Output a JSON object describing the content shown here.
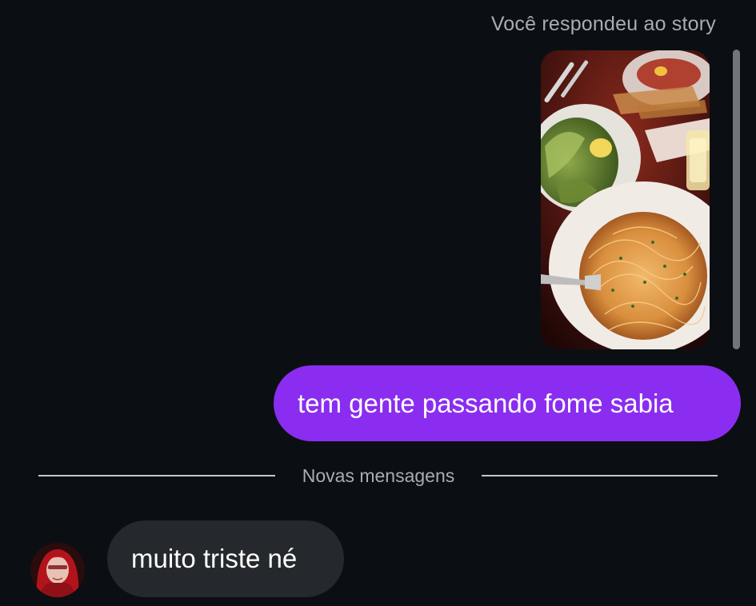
{
  "thread": {
    "story_reply_caption": "Você respondeu ao story",
    "story_preview": {
      "image_description": "story photo of plates of spaghetti and salad on a restaurant table"
    },
    "sent_message": "tem gente passando fome sabia",
    "new_messages_divider": "Novas mensagens",
    "received_message": "muito triste né",
    "avatar": {
      "icon": "user-avatar"
    }
  },
  "colors": {
    "background": "#0b0f13",
    "sent_bubble": "#8a2df0",
    "received_bubble": "#25282c",
    "secondary_text": "#a7adb5",
    "divider": "#c3c8ce"
  }
}
